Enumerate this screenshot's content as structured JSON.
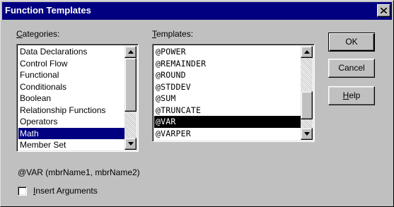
{
  "window": {
    "title": "Function Templates",
    "close_glyph": "×"
  },
  "categories": {
    "label_accel": "C",
    "label_rest": "ategories:",
    "items": [
      {
        "label": "Data Declarations",
        "selected": false
      },
      {
        "label": "Control Flow",
        "selected": false
      },
      {
        "label": "Functional",
        "selected": false
      },
      {
        "label": "Conditionals",
        "selected": false
      },
      {
        "label": "Boolean",
        "selected": false
      },
      {
        "label": "Relationship Functions",
        "selected": false
      },
      {
        "label": "Operators",
        "selected": false
      },
      {
        "label": "Math",
        "selected": true
      },
      {
        "label": "Member Set",
        "selected": false
      }
    ]
  },
  "templates": {
    "label_accel": "T",
    "label_rest": "emplates:",
    "items": [
      {
        "label": "@POWER",
        "selected": false
      },
      {
        "label": "@REMAINDER",
        "selected": false
      },
      {
        "label": "@ROUND",
        "selected": false
      },
      {
        "label": "@STDDEV",
        "selected": false
      },
      {
        "label": "@SUM",
        "selected": false
      },
      {
        "label": "@TRUNCATE",
        "selected": false
      },
      {
        "label": "@VAR",
        "selected": true
      },
      {
        "label": "@VARPER",
        "selected": false
      }
    ]
  },
  "buttons": {
    "ok": "OK",
    "cancel": "Cancel",
    "help_accel": "H",
    "help_rest": "elp"
  },
  "syntax_preview": "@VAR (mbrName1, mbrName2)",
  "insert_arguments": {
    "label_accel": "I",
    "label_rest": "nsert Arguments",
    "checked": false
  },
  "colors": {
    "title_bar": "#000080",
    "face": "#c0c0c0",
    "selection": "#000080"
  }
}
